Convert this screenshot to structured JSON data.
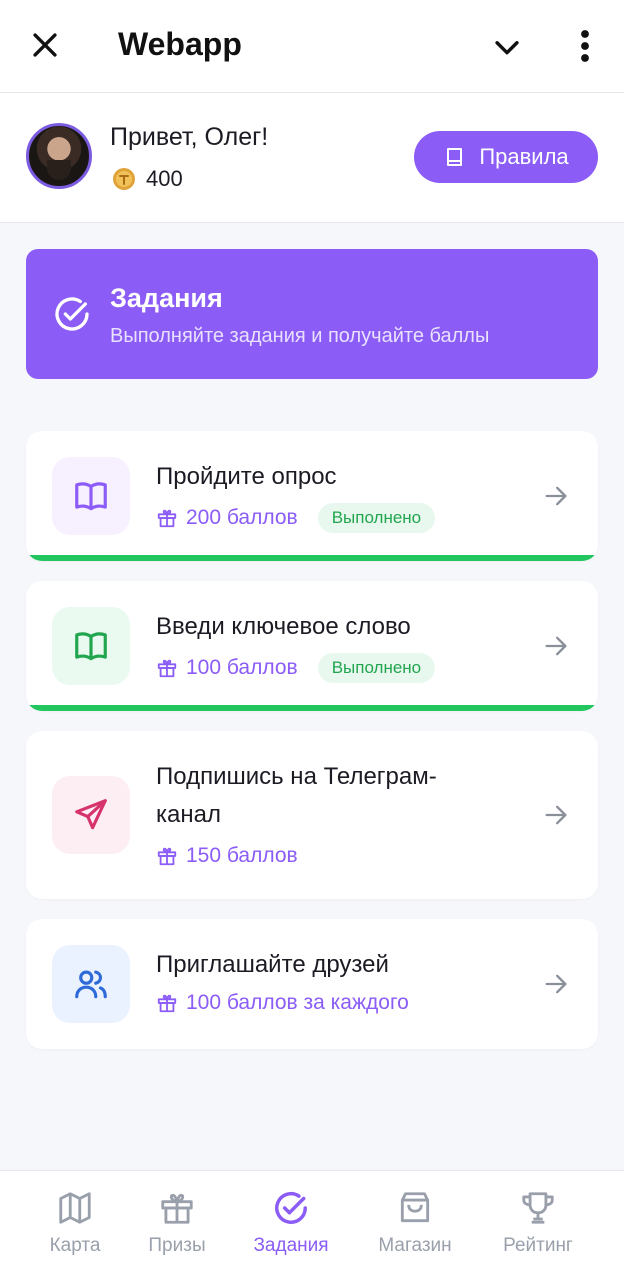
{
  "app": {
    "title": "Webapp"
  },
  "user": {
    "greeting": "Привет, Олег!",
    "points": "400"
  },
  "header": {
    "rules_label": "Правила"
  },
  "banner": {
    "title": "Задания",
    "subtitle": "Выполняйте задания и получайте баллы"
  },
  "tasks": [
    {
      "title": "Пройдите опрос",
      "reward": "200 баллов",
      "status": "Выполнено",
      "icon": "book-open-icon",
      "color": "#8b5cf6",
      "bg": "#f6f0ff"
    },
    {
      "title": "Введи ключевое слово",
      "reward": "100 баллов",
      "status": "Выполнено",
      "icon": "book-open-icon",
      "color": "#22a54f",
      "bg": "#eafaf0"
    },
    {
      "title_line1": "Подпишись на Телеграм-",
      "title_line2": "канал",
      "reward": "150 баллов",
      "icon": "send-icon",
      "color": "#d6336c",
      "bg": "#fdeef3"
    },
    {
      "title": "Приглашайте друзей",
      "reward": "100 баллов за каждого",
      "icon": "users-icon",
      "color": "#2f6bd8",
      "bg": "#eaf2ff"
    }
  ],
  "nav": [
    {
      "label": "Карта",
      "icon": "map-icon",
      "active": false
    },
    {
      "label": "Призы",
      "icon": "gift-icon",
      "active": false
    },
    {
      "label": "Задания",
      "icon": "check-circle-icon",
      "active": true
    },
    {
      "label": "Магазин",
      "icon": "shopping-bag-icon",
      "active": false
    },
    {
      "label": "Рейтинг",
      "icon": "trophy-icon",
      "active": false
    }
  ],
  "colors": {
    "accent": "#8b5cf6",
    "success": "#22c55e",
    "muted": "#9aa0ab"
  }
}
